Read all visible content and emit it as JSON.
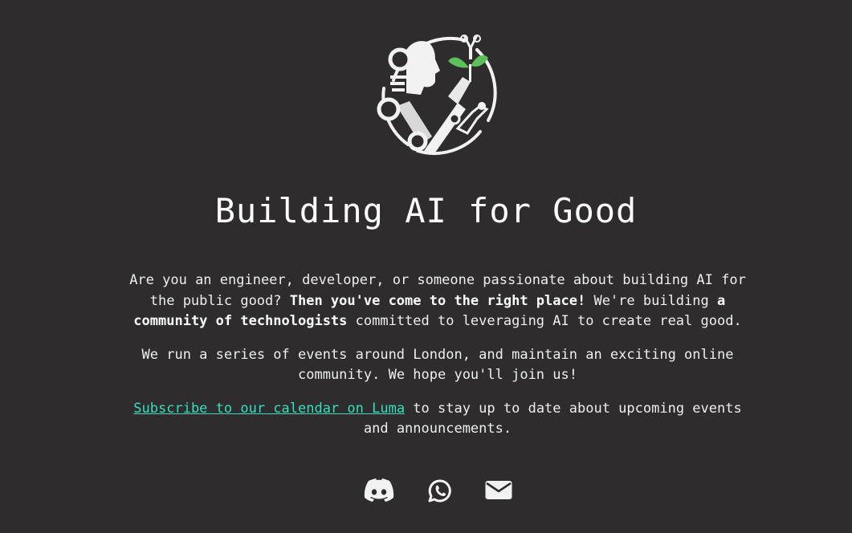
{
  "logo": {
    "icon": "robot-plant-logo-icon"
  },
  "hero": {
    "title": "Building AI for Good"
  },
  "intro": {
    "text_1": "Are you an engineer, developer, or someone passionate about building AI for the public good? ",
    "bold_1": "Then you've come to the right place!",
    "text_2": " We're building ",
    "bold_2": "a community of technologists",
    "text_3": " committed to leveraging AI to create real good."
  },
  "events": {
    "text": "We run a series of events around London, and maintain an exciting online community. We hope you'll join us!"
  },
  "subscribe": {
    "link_text": "Subscribe to our calendar on Luma",
    "text": " to stay up to date about upcoming events and announcements."
  },
  "socials": [
    {
      "name": "discord",
      "icon": "discord-icon"
    },
    {
      "name": "whatsapp",
      "icon": "whatsapp-icon"
    },
    {
      "name": "email",
      "icon": "envelope-icon"
    }
  ],
  "colors": {
    "background": "#2e2c2c",
    "text": "#efefef",
    "link": "#35dfc0",
    "leaf": "#5cc05a"
  }
}
